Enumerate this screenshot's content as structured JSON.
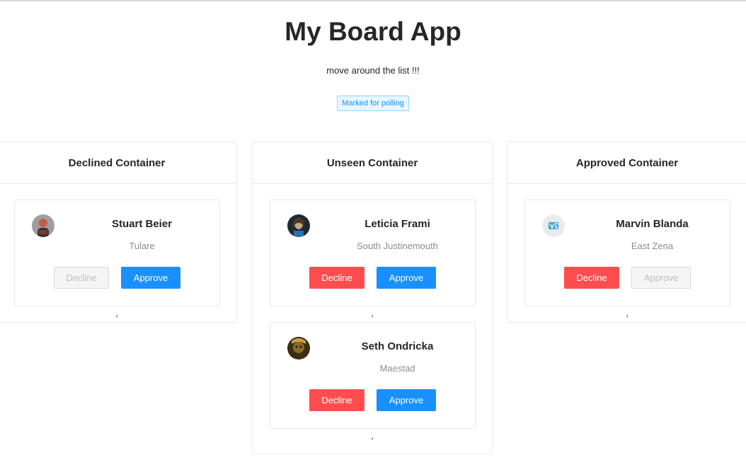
{
  "header": {
    "title": "My Board App",
    "subtitle": "move around the list !!!",
    "tag": "Marked for polling"
  },
  "columns": [
    {
      "title": "Declined Container",
      "cards": [
        {
          "name": "Stuart Beier",
          "city": "Tulare",
          "decline_label": "Decline",
          "approve_label": "Approve",
          "decline_enabled": false,
          "approve_enabled": true,
          "separator": ","
        }
      ]
    },
    {
      "title": "Unseen Container",
      "cards": [
        {
          "name": "Leticia Frami",
          "city": "South Justinemouth",
          "decline_label": "Decline",
          "approve_label": "Approve",
          "decline_enabled": true,
          "approve_enabled": true,
          "separator": ","
        },
        {
          "name": "Seth Ondricka",
          "city": "Maestad",
          "decline_label": "Decline",
          "approve_label": "Approve",
          "decline_enabled": true,
          "approve_enabled": true,
          "separator": ","
        }
      ]
    },
    {
      "title": "Approved Container",
      "cards": [
        {
          "name": "Marvin Blanda",
          "city": "East Zena",
          "decline_label": "Decline",
          "approve_label": "Approve",
          "decline_enabled": true,
          "approve_enabled": false,
          "separator": ","
        }
      ]
    }
  ],
  "colors": {
    "primary": "#1890ff",
    "danger": "#ff4d4f",
    "disabled_bg": "#f5f5f5",
    "disabled_text": "#bfbfbf",
    "tag_bg": "#e6f7ff"
  }
}
